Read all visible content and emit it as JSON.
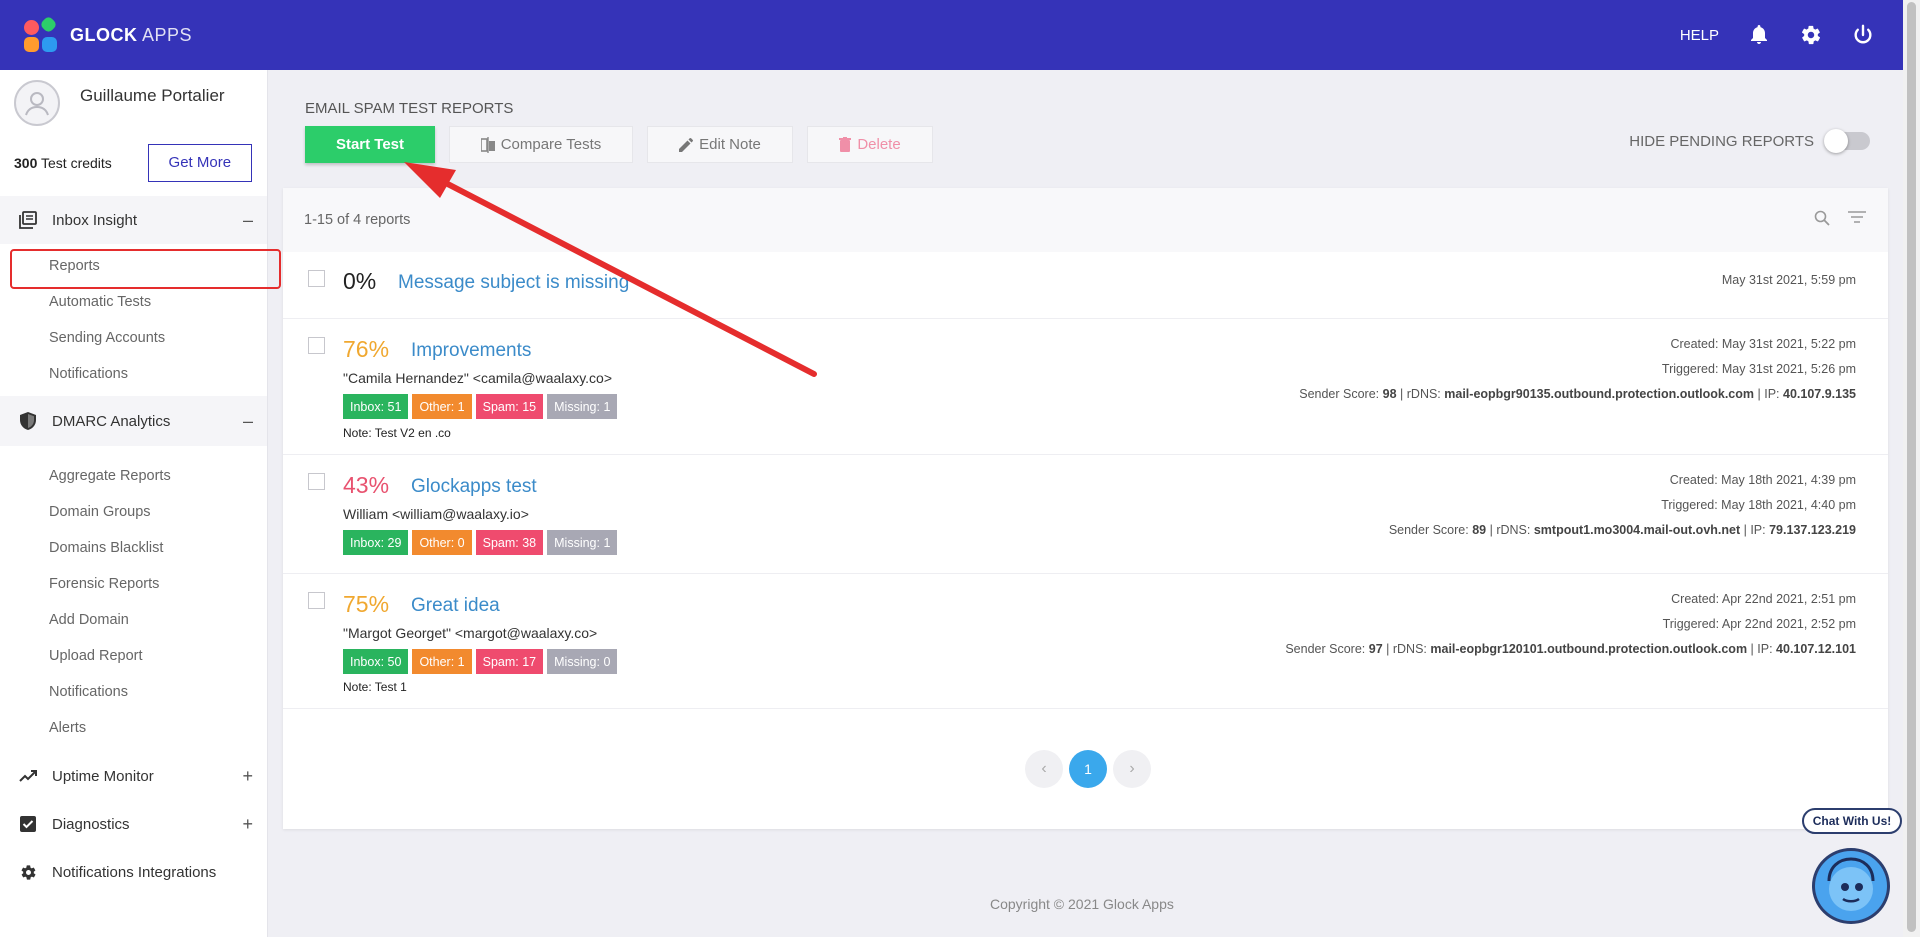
{
  "app": {
    "logo_bold": "GLOCK",
    "logo_light": "APPS",
    "help_label": "HELP",
    "icons": [
      "bell-icon",
      "gear-icon",
      "power-icon"
    ]
  },
  "user": {
    "name": "Guillaume Portalier",
    "credits_count": "300",
    "credits_label": "Test credits",
    "get_more_label": "Get More"
  },
  "sidebar": {
    "inbox_insight": {
      "label": "Inbox Insight",
      "toggle": "–",
      "items": [
        "Reports",
        "Automatic Tests",
        "Sending Accounts",
        "Notifications"
      ]
    },
    "dmarc": {
      "label": "DMARC Analytics",
      "toggle": "–",
      "items": [
        "Aggregate Reports",
        "Domain Groups",
        "Domains Blacklist",
        "Forensic Reports",
        "Add Domain",
        "Upload Report",
        "Notifications",
        "Alerts"
      ]
    },
    "uptime": {
      "label": "Uptime Monitor",
      "toggle": "+"
    },
    "diagnostics": {
      "label": "Diagnostics",
      "toggle": "+"
    },
    "integrations": {
      "label": "Notifications Integrations"
    }
  },
  "main": {
    "page_title": "EMAIL SPAM TEST REPORTS",
    "buttons": {
      "start": "Start Test",
      "compare": "Compare Tests",
      "edit": "Edit Note",
      "delete": "Delete"
    },
    "hide_pending_label": "HIDE PENDING REPORTS",
    "hide_pending_on": false,
    "list_summary": "1-15 of 4 reports",
    "reports": [
      {
        "pct": "0%",
        "pct_color": "#222222",
        "subject": "Message subject is missing",
        "date": "May 31st 2021, 5:59 pm"
      },
      {
        "pct": "76%",
        "pct_color": "#f0a830",
        "subject": "Improvements",
        "from": "\"Camila Hernandez\" <camila@waalaxy.co>",
        "inbox": "Inbox: 51",
        "other": "Other: 1",
        "spam": "Spam: 15",
        "missing": "Missing: 1",
        "note": "Note: Test V2 en .co",
        "created": "Created: May 31st 2021, 5:22 pm",
        "triggered": "Triggered: May 31st 2021, 5:26 pm",
        "sender_score_label": "Sender Score:",
        "sender_score": "98",
        "rdns_label": "| rDNS:",
        "rdns": "mail-eopbgr90135.outbound.protection.outlook.com",
        "ip_label": "| IP:",
        "ip": "40.107.9.135"
      },
      {
        "pct": "43%",
        "pct_color": "#e8526f",
        "subject": "Glockapps test",
        "from": "William <william@waalaxy.io>",
        "inbox": "Inbox: 29",
        "other": "Other: 0",
        "spam": "Spam: 38",
        "missing": "Missing: 1",
        "created": "Created: May 18th 2021, 4:39 pm",
        "triggered": "Triggered: May 18th 2021, 4:40 pm",
        "sender_score_label": "Sender Score:",
        "sender_score": "89",
        "rdns_label": "| rDNS:",
        "rdns": "smtpout1.mo3004.mail-out.ovh.net",
        "ip_label": "| IP:",
        "ip": "79.137.123.219"
      },
      {
        "pct": "75%",
        "pct_color": "#f0a830",
        "subject": "Great idea",
        "from": "\"Margot Georget\" <margot@waalaxy.co>",
        "inbox": "Inbox: 50",
        "other": "Other: 1",
        "spam": "Spam: 17",
        "missing": "Missing: 0",
        "note": "Note: Test 1",
        "created": "Created: Apr 22nd 2021, 2:51 pm",
        "triggered": "Triggered: Apr 22nd 2021, 2:52 pm",
        "sender_score_label": "Sender Score:",
        "sender_score": "97",
        "rdns_label": "| rDNS:",
        "rdns": "mail-eopbgr120101.outbound.protection.outlook.com",
        "ip_label": "| IP:",
        "ip": "40.107.12.101"
      }
    ],
    "pagination": {
      "prev": "‹",
      "current": "1",
      "next": "›"
    }
  },
  "footer": "Copyright © 2021 Glock Apps",
  "chat": {
    "label": "Chat With Us!"
  },
  "colors": {
    "topbar": "#3533b8",
    "accent_green": "#2ccd6a",
    "link_blue": "#3b8bc9",
    "annotation_red": "#e52d2d"
  }
}
